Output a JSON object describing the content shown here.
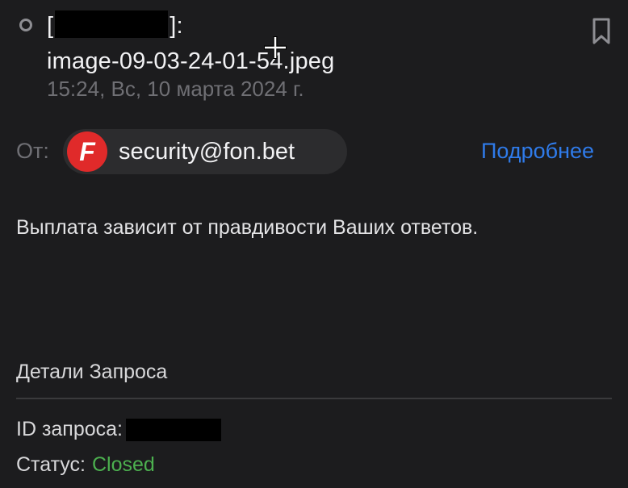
{
  "message": {
    "subject_prefix": "[",
    "subject_suffix": "]:",
    "subject_filename": "image-09-03-24-01-54.jpeg",
    "datetime": "15:24, Вс, 10 марта 2024 г."
  },
  "sender": {
    "from_label": "От:",
    "logo_letter": "F",
    "email": "security@fon.bet",
    "details_link": "Подробнее"
  },
  "body": {
    "text": "Выплата зависит от правдивости Ваших ответов."
  },
  "request_details": {
    "title": "Детали Запроса",
    "id_label": "ID запроса:",
    "status_label": "Статус:",
    "status_value": "Closed"
  },
  "icons": {
    "unread": "unread-dot-icon",
    "bookmark": "bookmark-icon",
    "cursor": "crosshair-cursor-icon"
  },
  "colors": {
    "background": "#1c1c1e",
    "link": "#2f7bea",
    "status_closed": "#4cb04f",
    "logo_red": "#e02a2a"
  }
}
